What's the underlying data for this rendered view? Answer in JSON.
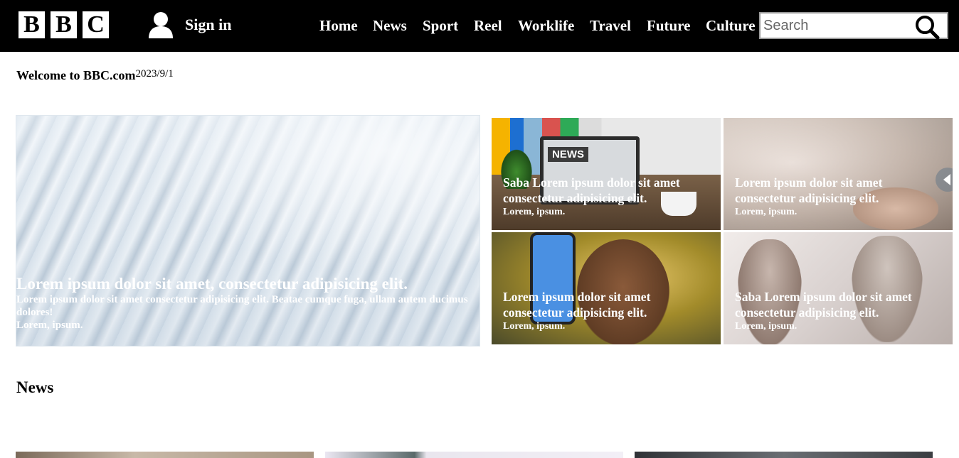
{
  "header": {
    "logo_letters": [
      "B",
      "B",
      "C"
    ],
    "sign_in_label": "Sign in",
    "nav": [
      {
        "label": "Home"
      },
      {
        "label": "News"
      },
      {
        "label": "Sport"
      },
      {
        "label": "Reel"
      },
      {
        "label": "Worklife"
      },
      {
        "label": "Travel"
      },
      {
        "label": "Future"
      },
      {
        "label": "Culture"
      }
    ],
    "search": {
      "placeholder": "Search",
      "value": ""
    }
  },
  "welcome": {
    "title": "Welcome to BBC.com",
    "date": "2023/9/1"
  },
  "hero": {
    "headline": "Lorem ipsum dolor sit amet, consectetur adipisicing elit.",
    "summary": "Lorem ipsum dolor sit amet consectetur adipisicing elit. Beatae cumque fuga, ullam autem ducimus dolores!",
    "tag": "Lorem, ipsum."
  },
  "cards": [
    {
      "headline": "Saba Lorem ipsum dolor sit amet consectetur adipisicing elit.",
      "tag": "Lorem, ipsum.",
      "image_text": "NEWS"
    },
    {
      "headline": "Lorem ipsum dolor sit amet consectetur adipisicing elit.",
      "tag": "Lorem, ipsum."
    },
    {
      "headline": "Lorem ipsum dolor sit amet consectetur adipisicing elit.",
      "tag": "Lorem, ipsum."
    },
    {
      "headline": "Saba Lorem ipsum dolor sit amet consectetur adipisicing elit.",
      "tag": "Lorem, ipsum."
    }
  ],
  "sections": {
    "news_title": "News"
  },
  "colors": {
    "header_bg": "#000000",
    "page_bg": "#ffffff",
    "text": "#000000",
    "caption_text": "#ffffff"
  },
  "icons": [
    "user-icon",
    "search-icon",
    "carousel-arrow-icon"
  ]
}
